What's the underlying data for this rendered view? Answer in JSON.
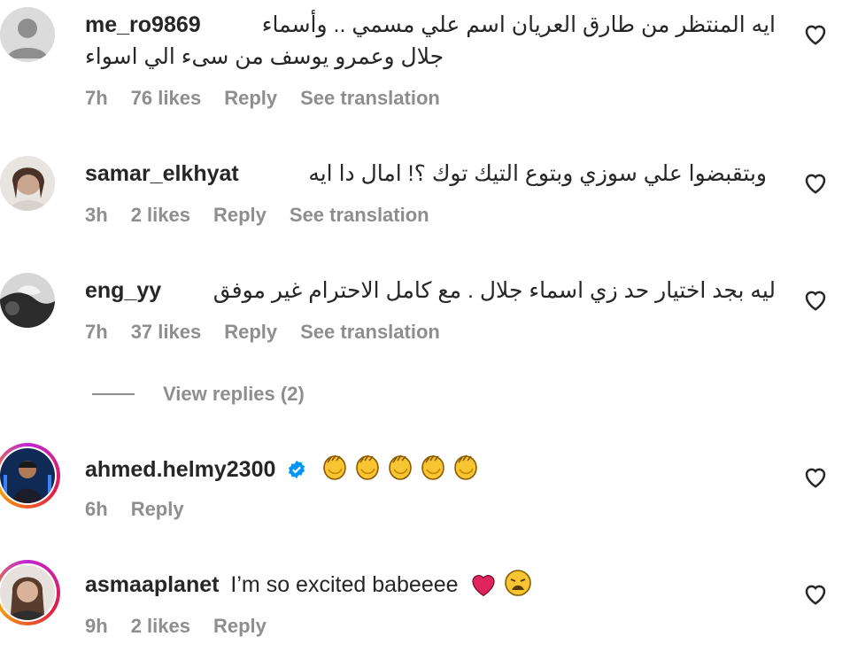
{
  "comments": [
    {
      "username": "me_ro9869",
      "text_line1": "ايه المنتظر من طارق العريان اسم علي مسمي .. وأسماء",
      "text_line2": "جلال وعمرو يوسف من سىء الي اسواء",
      "time": "7h",
      "likes": "76 likes",
      "reply": "Reply",
      "translation": "See translation"
    },
    {
      "username": "samar_elkhyat",
      "text": "وبتقبضوا علي سوزي وبتوع التيك توك ؟! امال دا ايه",
      "time": "3h",
      "likes": "2 likes",
      "reply": "Reply",
      "translation": "See translation"
    },
    {
      "username": "eng_yy",
      "text": "ليه بجد اختيار حد زي اسماء جلال . مع كامل الاحترام غير موفق",
      "time": "7h",
      "likes": "37 likes",
      "reply": "Reply",
      "translation": "See translation"
    },
    {
      "username": "ahmed.helmy2300",
      "text": "",
      "emoji": "clapping-hands x5",
      "time": "6h",
      "reply": "Reply"
    },
    {
      "username": "asmaaplanet",
      "text": "I’m so excited babeeee",
      "emoji": "heart, weary-face",
      "time": "9h",
      "likes": "2 likes",
      "reply": "Reply"
    }
  ],
  "view_replies": "View replies (2)",
  "colors": {
    "text": "#262626",
    "muted": "#8e8e8e",
    "verified": "#0095f6",
    "story_ring": "#e11d48"
  },
  "icons": [
    "avatar-placeholder-icon",
    "heart-outline-icon",
    "verified-badge-icon",
    "clapping-hands-icon",
    "red-heart-icon",
    "weary-face-icon"
  ]
}
